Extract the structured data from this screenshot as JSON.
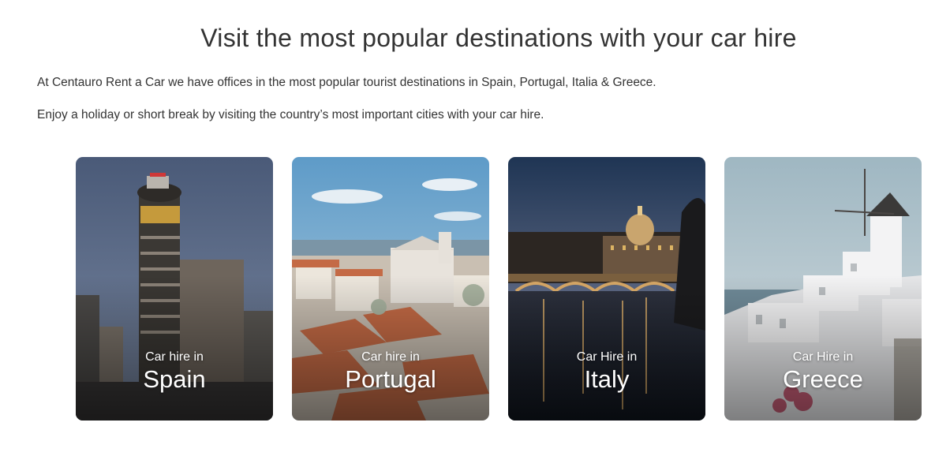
{
  "heading": "Visit the most popular destinations with your car hire",
  "intro": {
    "line1": "At Centauro Rent a Car we have offices in the most popular tourist destinations in Spain, Portugal, Italia & Greece.",
    "line2": "Enjoy a holiday or short break by visiting the country’s most important cities with your car hire."
  },
  "destinations": [
    {
      "sub": "Car hire in",
      "name": "Spain"
    },
    {
      "sub": "Car hire in",
      "name": "Portugal"
    },
    {
      "sub": "Car Hire in",
      "name": "Italy"
    },
    {
      "sub": "Car Hire in",
      "name": "Greece"
    }
  ]
}
